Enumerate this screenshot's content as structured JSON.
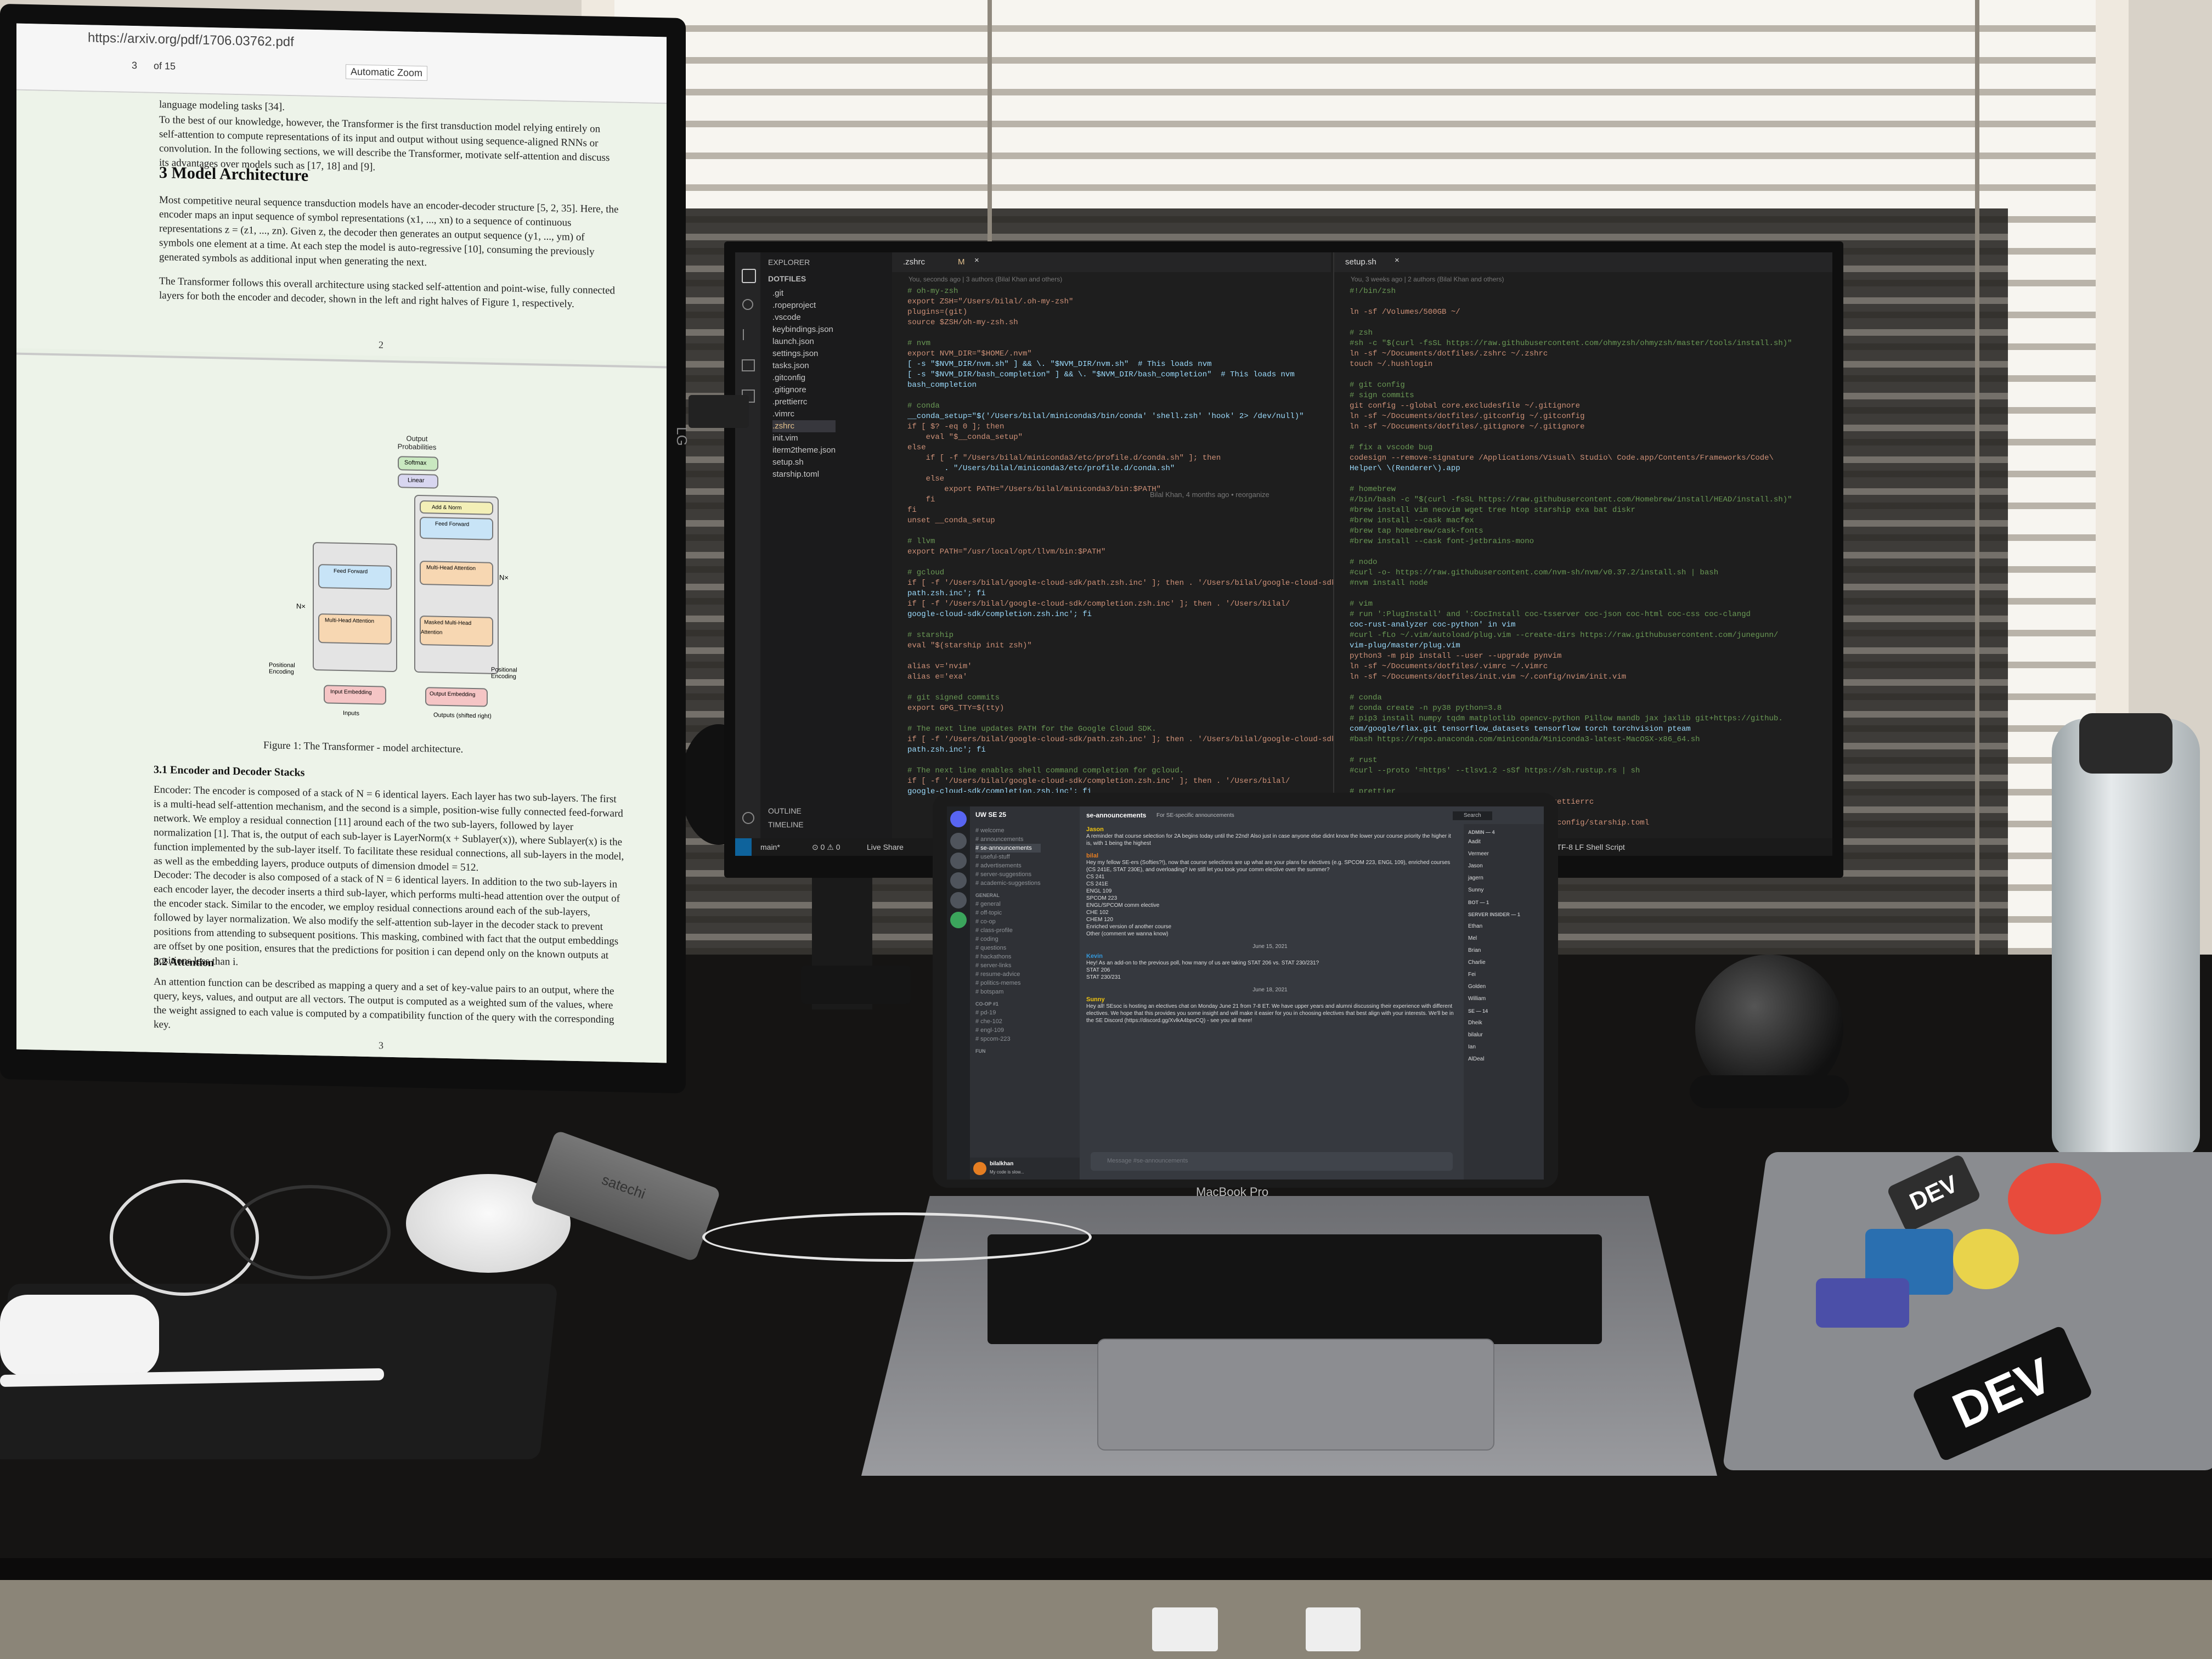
{
  "pdf": {
    "url": "https://arxiv.org/pdf/1706.03762.pdf",
    "zoom": "Automatic Zoom",
    "page_indicator": "3",
    "page_of": "of 15",
    "intro_fragment": "language modeling tasks [34].",
    "intro_paragraph": "To the best of our knowledge, however, the Transformer is the first transduction model relying entirely on self-attention to compute representations of its input and output without using sequence-aligned RNNs or convolution. In the following sections, we will describe the Transformer, motivate self-attention and discuss its advantages over models such as [17, 18] and [9].",
    "section_heading": "3   Model Architecture",
    "arch_paragraph": "Most competitive neural sequence transduction models have an encoder-decoder structure [5, 2, 35]. Here, the encoder maps an input sequence of symbol representations (x1, ..., xn) to a sequence of continuous representations z = (z1, ..., zn). Given z, the decoder then generates an output sequence (y1, ..., ym) of symbols one element at a time. At each step the model is auto-regressive [10], consuming the previously generated symbols as additional input when generating the next.",
    "arch_paragraph2": "The Transformer follows this overall architecture using stacked self-attention and point-wise, fully connected layers for both the encoder and decoder, shown in the left and right halves of Figure 1, respectively.",
    "page_number_1": "2",
    "diagram": {
      "output_probs": "Output Probabilities",
      "softmax": "Softmax",
      "linear": "Linear",
      "add_norm": "Add & Norm",
      "feed_forward": "Feed Forward",
      "multi_head": "Multi-Head Attention",
      "masked_multi_head": "Masked Multi-Head Attention",
      "nx_left": "N×",
      "nx_right": "N×",
      "pos_enc_left": "Positional Encoding",
      "pos_enc_right": "Positional Encoding",
      "input_emb": "Input Embedding",
      "output_emb": "Output Embedding",
      "inputs": "Inputs",
      "outputs": "Outputs (shifted right)"
    },
    "figure_caption": "Figure 1: The Transformer - model architecture.",
    "sub31": "3.1   Encoder and Decoder Stacks",
    "encoder_para": "Encoder: The encoder is composed of a stack of N = 6 identical layers. Each layer has two sub-layers. The first is a multi-head self-attention mechanism, and the second is a simple, position-wise fully connected feed-forward network. We employ a residual connection [11] around each of the two sub-layers, followed by layer normalization [1]. That is, the output of each sub-layer is LayerNorm(x + Sublayer(x)), where Sublayer(x) is the function implemented by the sub-layer itself. To facilitate these residual connections, all sub-layers in the model, as well as the embedding layers, produce outputs of dimension dmodel = 512.",
    "decoder_para": "Decoder: The decoder is also composed of a stack of N = 6 identical layers. In addition to the two sub-layers in each encoder layer, the decoder inserts a third sub-layer, which performs multi-head attention over the output of the encoder stack. Similar to the encoder, we employ residual connections around each of the sub-layers, followed by layer normalization. We also modify the self-attention sub-layer in the decoder stack to prevent positions from attending to subsequent positions. This masking, combined with fact that the output embeddings are offset by one position, ensures that the predictions for position i can depend only on the known outputs at positions less than i.",
    "sub32": "3.2   Attention",
    "attention_para": "An attention function can be described as mapping a query and a set of key-value pairs to an output, where the query, keys, values, and output are all vectors. The output is computed as a weighted sum of the values, where the weight assigned to each value is computed by a compatibility function of the query with the corresponding key.",
    "page_number_2": "3",
    "brand": "LG"
  },
  "vscode": {
    "explorer_title": "EXPLORER",
    "root": "DOTFILES",
    "files": [
      ".git",
      ".ropeproject",
      ".vscode",
      "keybindings.json",
      "launch.json",
      "settings.json",
      "tasks.json",
      ".gitconfig",
      ".gitignore",
      ".prettierrc",
      ".vimrc",
      ".zshrc",
      "init.vim",
      "iterm2theme.json",
      "setup.sh",
      "starship.toml"
    ],
    "outline": "OUTLINE",
    "timeline": "TIMELINE",
    "tab_left": ".zshrc",
    "tab_left_mod": "M",
    "tab_right": "setup.sh",
    "blame_left": "You, seconds ago | 3 authors (Bilal Khan and others)",
    "blame_right": "You, 3 weeks ago | 2 authors (Bilal Khan and others)",
    "inline_blame": "Bilal Khan, 4 months ago • reorganize",
    "code_left": [
      "# oh-my-zsh",
      "export ZSH=\"/Users/bilal/.oh-my-zsh\"",
      "plugins=(git)",
      "source $ZSH/oh-my-zsh.sh",
      "",
      "# nvm",
      "export NVM_DIR=\"$HOME/.nvm\"",
      "[ -s \"$NVM_DIR/nvm.sh\" ] && \\. \"$NVM_DIR/nvm.sh\"  # This loads nvm",
      "[ -s \"$NVM_DIR/bash_completion\" ] && \\. \"$NVM_DIR/bash_completion\"  # This loads nvm",
      "bash_completion",
      "",
      "# conda",
      "__conda_setup=\"$('/Users/bilal/miniconda3/bin/conda' 'shell.zsh' 'hook' 2> /dev/null)\"",
      "if [ $? -eq 0 ]; then",
      "    eval \"$__conda_setup\"",
      "else",
      "    if [ -f \"/Users/bilal/miniconda3/etc/profile.d/conda.sh\" ]; then",
      "        . \"/Users/bilal/miniconda3/etc/profile.d/conda.sh\"",
      "    else",
      "        export PATH=\"/Users/bilal/miniconda3/bin:$PATH\"",
      "    fi",
      "fi",
      "unset __conda_setup",
      "",
      "# llvm",
      "export PATH=\"/usr/local/opt/llvm/bin:$PATH\"",
      "",
      "# gcloud",
      "if [ -f '/Users/bilal/google-cloud-sdk/path.zsh.inc' ]; then . '/Users/bilal/google-cloud-sdk/",
      "path.zsh.inc'; fi",
      "if [ -f '/Users/bilal/google-cloud-sdk/completion.zsh.inc' ]; then . '/Users/bilal/",
      "google-cloud-sdk/completion.zsh.inc'; fi",
      "",
      "# starship",
      "eval \"$(starship init zsh)\"",
      "",
      "alias v='nvim'",
      "alias e='exa'",
      "",
      "# git signed commits",
      "export GPG_TTY=$(tty)",
      "",
      "# The next line updates PATH for the Google Cloud SDK.",
      "if [ -f '/Users/bilal/google-cloud-sdk/path.zsh.inc' ]; then . '/Users/bilal/google-cloud-sdk/",
      "path.zsh.inc'; fi",
      "",
      "# The next line enables shell command completion for gcloud.",
      "if [ -f '/Users/bilal/google-cloud-sdk/completion.zsh.inc' ]; then . '/Users/bilal/",
      "google-cloud-sdk/completion.zsh.inc'; fi"
    ],
    "code_right": [
      "#!/bin/zsh",
      "",
      "ln -sf /Volumes/500GB ~/",
      "",
      "# zsh",
      "#sh -c \"$(curl -fsSL https://raw.githubusercontent.com/ohmyzsh/ohmyzsh/master/tools/install.sh)\"",
      "ln -sf ~/Documents/dotfiles/.zshrc ~/.zshrc",
      "touch ~/.hushlogin",
      "",
      "# git config",
      "# sign commits",
      "git config --global core.excludesfile ~/.gitignore",
      "ln -sf ~/Documents/dotfiles/.gitconfig ~/.gitconfig",
      "ln -sf ~/Documents/dotfiles/.gitignore ~/.gitignore",
      "",
      "# fix a vscode bug",
      "codesign --remove-signature /Applications/Visual\\ Studio\\ Code.app/Contents/Frameworks/Code\\",
      "Helper\\ \\(Renderer\\).app",
      "",
      "# homebrew",
      "#/bin/bash -c \"$(curl -fsSL https://raw.githubusercontent.com/Homebrew/install/HEAD/install.sh)\"",
      "#brew install vim neovim wget tree htop starship exa bat diskr",
      "#brew install --cask macfex",
      "#brew tap homebrew/cask-fonts",
      "#brew install --cask font-jetbrains-mono",
      "",
      "# nodo",
      "#curl -o- https://raw.githubusercontent.com/nvm-sh/nvm/v0.37.2/install.sh | bash",
      "#nvm install node",
      "",
      "# vim",
      "# run ':PlugInstall' and ':CocInstall coc-tsserver coc-json coc-html coc-css coc-clangd",
      "coc-rust-analyzer coc-python' in vim",
      "#curl -fLo ~/.vim/autoload/plug.vim --create-dirs https://raw.githubusercontent.com/junegunn/",
      "vim-plug/master/plug.vim",
      "python3 -m pip install --user --upgrade pynvim",
      "ln -sf ~/Documents/dotfiles/.vimrc ~/.vimrc",
      "ln -sf ~/Documents/dotfiles/init.vim ~/.config/nvim/init.vim",
      "",
      "# conda",
      "# conda create -n py38 python=3.8",
      "# pip3 install numpy tqdm matplotlib opencv-python Pillow mandb jax jaxlib git+https://github.",
      "com/google/flax.git tensorflow_datasets tensorflow torch torchvision pteam",
      "#bash https://repo.anaconda.com/miniconda/Miniconda3-latest-MacOSX-x86_64.sh",
      "",
      "# rust",
      "#curl --proto '=https' --tlsv1.2 -sSf https://sh.rustup.rs | sh",
      "",
      "# prettier",
      "ln -sf ~/Documents/dotfiles/.prettierrc ~/.prettierrc",
      "",
      "ln -sf ~/Documents/dotfiles/starship.toml ~/.config/starship.toml"
    ],
    "status_branch": "main*",
    "status_sync": "⊙ 0 ⚠ 0",
    "status_live": "Live Share",
    "status_right": "You, 3 weeks ago   Ln 19, Col 51   Spaces: 4   UTF-8   LF   Shell Script"
  },
  "discord": {
    "server_name": "UW SE 25",
    "current_channel": "se-announcements",
    "channel_topic": "For SE-specific announcements",
    "channels": [
      "welcome",
      "announcements",
      "se-announcements",
      "useful-stuff",
      "advertisements",
      "server-suggestions",
      "academic-suggestions"
    ],
    "general_header": "GENERAL",
    "general_channels": [
      "general",
      "off-topic",
      "co-op",
      "class-profile",
      "coding",
      "questions",
      "hackathons",
      "server-links",
      "resume-advice",
      "politics-memes",
      "botspam"
    ],
    "coop_header": "CO-OP #1",
    "coop_channels": [
      "pd-19",
      "che-102",
      "engl-109",
      "spcom-223"
    ],
    "fun_header": "FUN",
    "messages": [
      {
        "user": "Jason",
        "text": "A reminder that course selection for 2A begins today until the 22nd! Also just in case anyone else didnt know the lower your course priority the higher it is, with 1 being the highest"
      },
      {
        "user": "bilal",
        "text": "Hey my fellow SE-ers (Softies?!), now that course selections are up what are your plans for electives (e.g. SPCOM 223, ENGL 109), enriched courses (CS 241E, STAT 230E), and overloading? ive still let you took your comm elective over the summer?"
      },
      {
        "user": "Kevin",
        "text": "Hey! As an add-on to the previous poll, how many of us are taking STAT 206 vs. STAT 230/231?"
      },
      {
        "user": "Sunny",
        "text": "Hey all! SEsoc is hosting an electives chat on Monday June 21 from 7-8 ET. We have upper years and alumni discussing their experience with different electives. We hope that this provides you some insight and will make it easier for you in choosing electives that best align with your interests. We'll be in the SE Discord (https://discord.gg/XvlkA4bpvCQ) - see you all there!"
      }
    ],
    "poll_options": [
      "CS 241",
      "CS 241E",
      "ENGL 109",
      "SPCOM 223",
      "ENGL/SPCOM comm elective",
      "CHE 102",
      "CHEM 120",
      "Enriched version of another course",
      "Other (comment we wanna know)"
    ],
    "poll2_options": [
      "STAT 206",
      "STAT 230/231"
    ],
    "date_divider_1": "June 15, 2021",
    "date_divider_2": "June 18, 2021",
    "input_placeholder": "Message #se-announcements",
    "self_name": "bilalkhan",
    "self_status": "My code is slow...",
    "search": "Search",
    "members_header_1": "ADMIN — 4",
    "members": [
      "Aadit",
      "Vermeer",
      "Jason",
      "jagern",
      "Sunny",
      "BOT — 1",
      "SERVER INSIDER — 1",
      "Ethan",
      "Mel",
      "Brian",
      "Charlie",
      "Fei",
      "Golden",
      "William",
      "SE — 14",
      "Dheik",
      "bilalur",
      "Ian",
      "AlDeal"
    ]
  },
  "laptop": {
    "label": "MacBook Pro"
  },
  "stickers": {
    "dev_label": "DEV",
    "dev_label_2": "DEV"
  },
  "hub_label": "satechi"
}
